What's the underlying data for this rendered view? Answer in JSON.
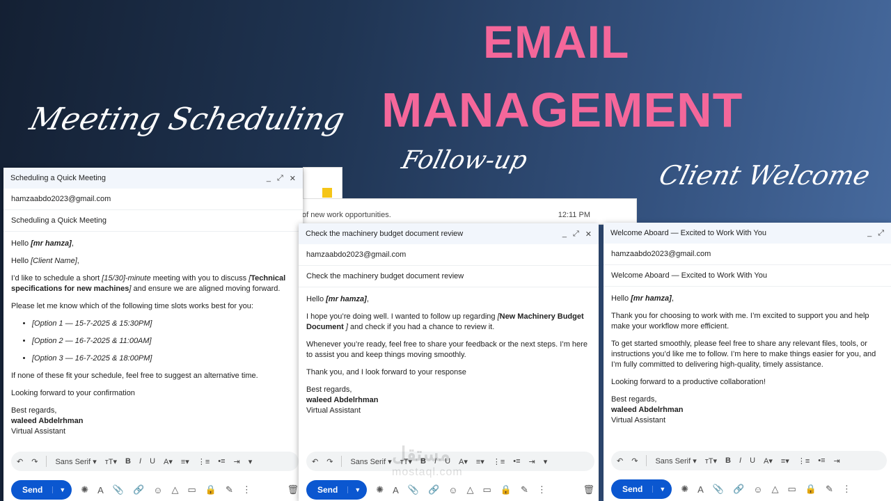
{
  "headline": {
    "line1": "EMAIL",
    "line2": "MANAGEMENT",
    "color": "#f4679a"
  },
  "script_labels": {
    "meeting": "Meeting Scheduling",
    "follow": "Follow-up",
    "client": "Client Welcome"
  },
  "background_inbox": {
    "snippet": "of new work opportunities.",
    "time": "12:11 PM"
  },
  "watermark": {
    "arabic": "مستقل",
    "latin": "mostaql.com"
  },
  "compose_toolbar": {
    "undo_icon": "↶",
    "redo_icon": "↷",
    "font": "Sans Serif ▾",
    "size_icon": "тT▾",
    "bold": "B",
    "italic": "I",
    "underline": "U",
    "text_color": "A▾",
    "align": "≡▾",
    "numbered_list": "⋮≡",
    "bulleted_list": "•≡",
    "indent": "⇥",
    "more": "▾"
  },
  "bottom_bar": {
    "send_label": "Send",
    "send_arrow": "▼",
    "icons": [
      "✺",
      "A",
      "📎",
      "🔗",
      "☺",
      "△",
      "▭",
      "🔒",
      "✎",
      "⋮"
    ],
    "trash_icon": "🗑"
  },
  "window_controls": {
    "minimize": "_",
    "expand": "⤢",
    "close": "✕"
  },
  "meeting_email": {
    "title": "Scheduling a Quick Meeting",
    "to": "hamzaabdo2023@gmail.com",
    "subject": "Scheduling a Quick Meeting",
    "greeting_pre": "Hello ",
    "greeting_name": "[mr hamza]",
    "greeting_post": ",",
    "hello2_pre": "Hello ",
    "hello2_name": "[Client Name]",
    "hello2_post": ",",
    "intro_a": "I’d like to schedule a short ",
    "intro_b": "[15/30]-minute",
    "intro_c": " meeting with you to discuss ",
    "intro_d": "[",
    "intro_e": "Technical specifications for new machines",
    "intro_f": "]",
    "intro_g": " and ensure we are aligned moving forward.",
    "slots_intro": "Please let me know which of the following time slots works best for you:",
    "options": [
      "[Option 1 — 15-7-2025 & 15:30PM]",
      "[Option 2 — 16-7-2025 & 11:00AM]",
      "[Option 3 — 16-7-2025 & 18:00PM]"
    ],
    "alt": "If none of these fit your schedule, feel free to suggest an alternative time.",
    "closing": "Looking forward to your confirmation",
    "regards": "Best regards,",
    "name": "waleed Abdelrhman",
    "role": "Virtual Assistant"
  },
  "followup_email": {
    "title": "Check the machinery budget document review",
    "to": "hamzaabdo2023@gmail.com",
    "subject": "Check the machinery budget document review",
    "greeting_pre": "Hello ",
    "greeting_name": "[mr hamza]",
    "greeting_post": ",",
    "p1_a": "I hope you’re doing well. I wanted to follow up regarding ",
    "p1_b": "[",
    "p1_c": "New Machinery Budget Document",
    "p1_d": " ]",
    "p1_e": " and check if you had a chance to review it.",
    "p2": "Whenever you’re ready, feel free to share your feedback or the next steps. I’m here to assist you and keep things moving smoothly.",
    "p3": "Thank you, and I look forward to your response",
    "regards": "Best regards,",
    "name": "waleed Abdelrhman",
    "role": "Virtual Assistant"
  },
  "welcome_email": {
    "title": "Welcome Aboard — Excited to Work With You",
    "to": "hamzaabdo2023@gmail.com",
    "subject": "Welcome Aboard — Excited to Work With You",
    "greeting_pre": "Hello ",
    "greeting_name": "[mr hamza]",
    "greeting_post": ",",
    "p1": "Thank you for choosing to work with me. I’m excited to support you and help make your workflow more efficient.",
    "p2": "To get started smoothly, please feel free to share any relevant files, tools, or instructions you’d like me to follow. I’m here to make things easier for you, and I’m fully committed to delivering high-quality, timely assistance.",
    "p3": "Looking forward to a productive collaboration!",
    "regards": "Best regards,",
    "name": "waleed Abdelrhman",
    "role": "Virtual Assistant"
  }
}
